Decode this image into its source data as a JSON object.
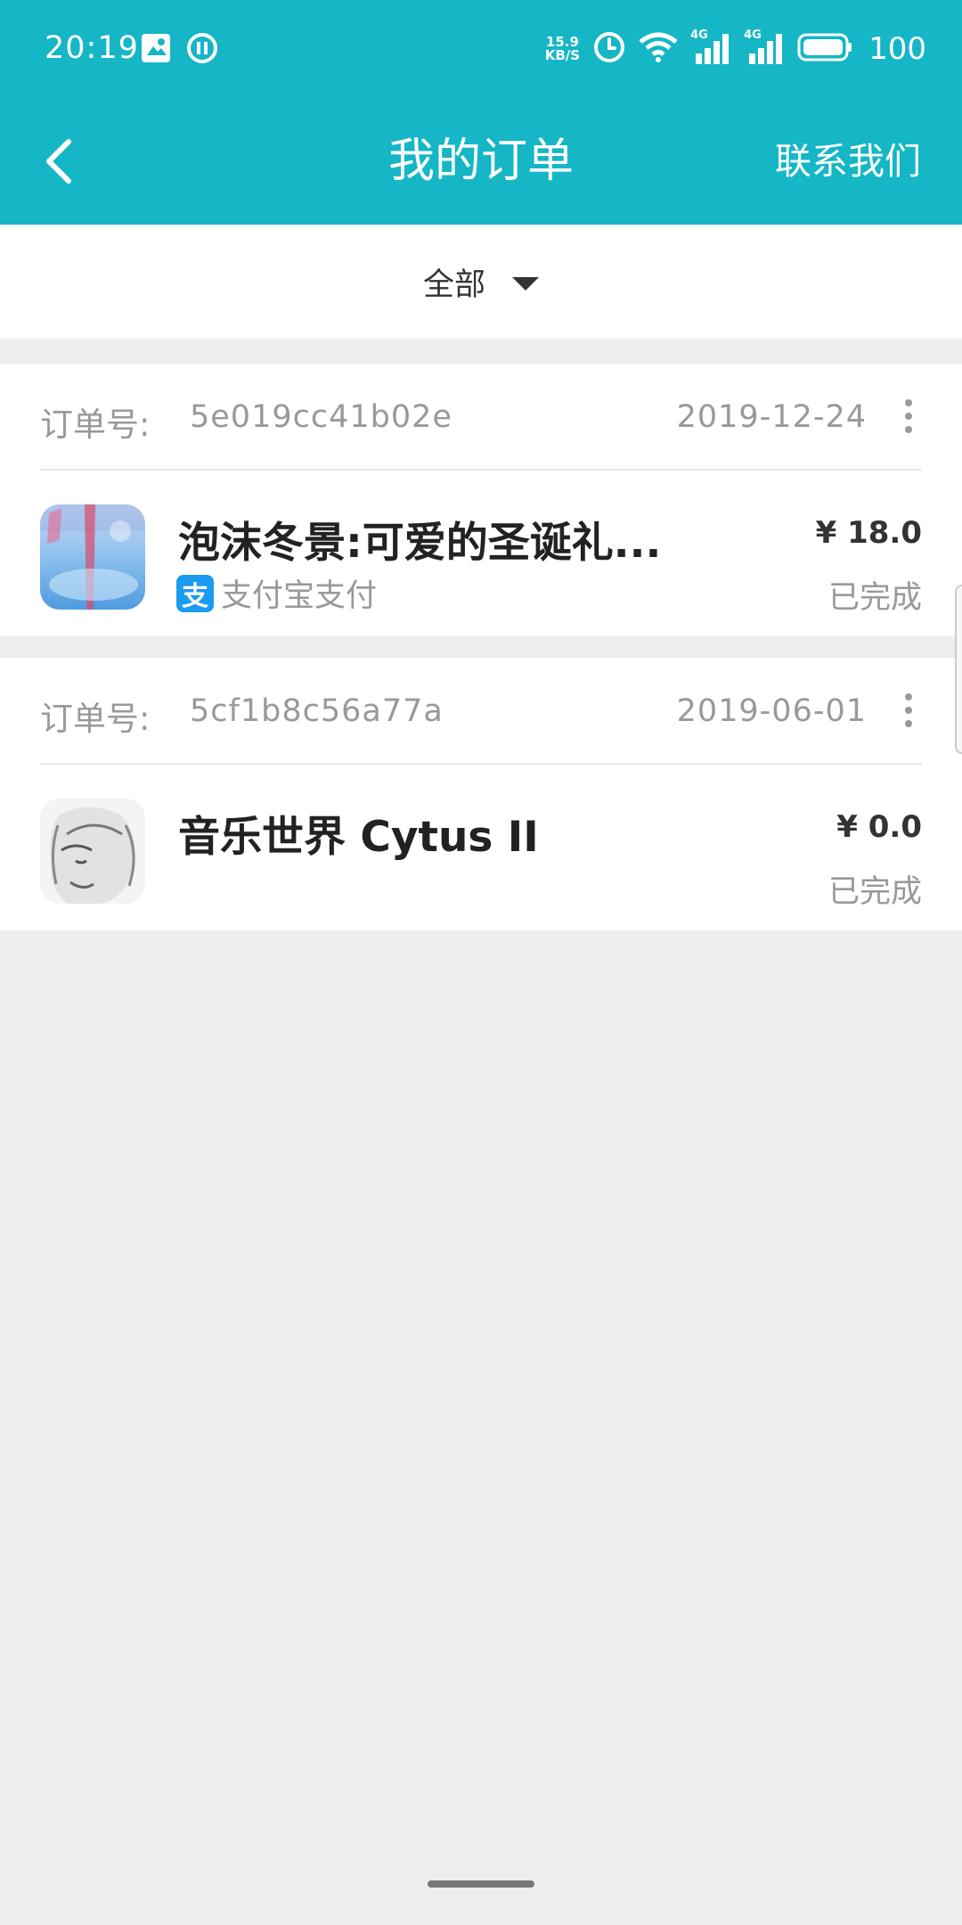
{
  "status_bar": {
    "time": "20:19",
    "net_speed_value": "15.9",
    "net_speed_unit": "KB/S",
    "signal_label_1": "4G",
    "signal_label_2": "4G",
    "battery": "100",
    "icons": [
      "photo-icon",
      "pause-circle-icon",
      "alarm-icon",
      "wifi-icon",
      "signal-icon",
      "signal-icon",
      "battery-icon"
    ]
  },
  "header": {
    "title": "我的订单",
    "contact_label": "联系我们",
    "background": "#15b6c6"
  },
  "filter": {
    "selected": "全部"
  },
  "orders": [
    {
      "order_no_label": "订单号:",
      "order_no": "5e019cc41b02e",
      "date": "2019-12-24",
      "app_name": "泡沫冬景:可爱的圣诞礼...",
      "payment_method": "支付宝支付",
      "payment_icon_char": "支",
      "price": "¥ 18.0",
      "status": "已完成"
    },
    {
      "order_no_label": "订单号:",
      "order_no": "5cf1b8c56a77a",
      "date": "2019-06-01",
      "app_name": "音乐世界 Cytus II",
      "price": "¥ 0.0",
      "status": "已完成"
    }
  ],
  "colors": {
    "accent": "#15b6c6",
    "alipay": "#1a9bf0",
    "page_bg": "#eeeeee"
  }
}
